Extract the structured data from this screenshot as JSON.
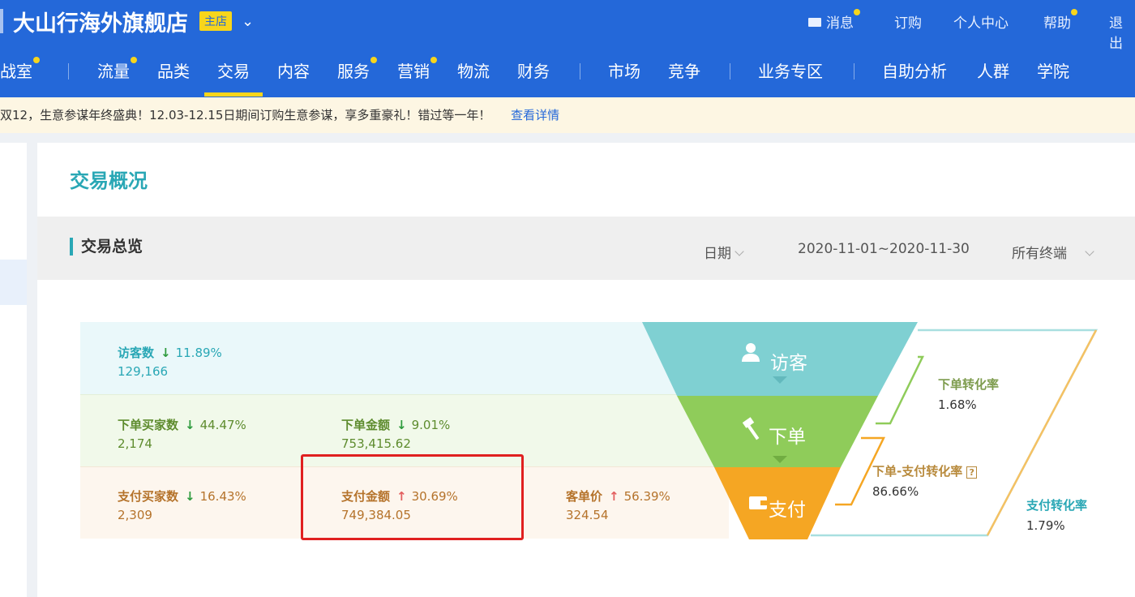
{
  "header": {
    "store_name": "大山行海外旗舰店",
    "store_tag": "主店",
    "util_links": [
      "消息",
      "订购",
      "个人中心",
      "帮助",
      "退出"
    ],
    "nav_items": [
      {
        "label": "作战室",
        "dot": true
      },
      {
        "label": "流量",
        "dot": true
      },
      {
        "label": "品类",
        "dot": false
      },
      {
        "label": "交易",
        "dot": false,
        "active": true
      },
      {
        "label": "内容",
        "dot": false
      },
      {
        "label": "服务",
        "dot": true
      },
      {
        "label": "营销",
        "dot": true
      },
      {
        "label": "物流",
        "dot": false
      },
      {
        "label": "财务",
        "dot": false
      },
      {
        "label": "市场",
        "dot": false
      },
      {
        "label": "竞争",
        "dot": false
      },
      {
        "label": "业务专区",
        "dot": false
      },
      {
        "label": "自助分析",
        "dot": false
      },
      {
        "label": "人群",
        "dot": false
      },
      {
        "label": "学院",
        "dot": false
      }
    ]
  },
  "notice": {
    "text": "双12，生意参谋年终盛典！12.03-12.15日期间订购生意参谋，享多重豪礼！错过等一年！",
    "link": "查看详情"
  },
  "page": {
    "title": "交易概况",
    "section_title": "交易总览",
    "filter_date_label": "日期",
    "date_range": "2020-11-01~2020-11-30",
    "terminal": "所有终端"
  },
  "metrics": {
    "visitors": {
      "label": "访客数",
      "change": "11.89%",
      "direction": "down",
      "value": "129,166"
    },
    "order_buyers": {
      "label": "下单买家数",
      "change": "44.47%",
      "direction": "down",
      "value": "2,174"
    },
    "order_amount": {
      "label": "下单金额",
      "change": "9.01%",
      "direction": "down",
      "value": "753,415.62"
    },
    "pay_buyers": {
      "label": "支付买家数",
      "change": "16.43%",
      "direction": "down",
      "value": "2,309"
    },
    "pay_amount": {
      "label": "支付金额",
      "change": "30.69%",
      "direction": "up",
      "value": "749,384.05"
    },
    "avg_order": {
      "label": "客单价",
      "change": "56.39%",
      "direction": "up",
      "value": "324.54"
    }
  },
  "funnel": {
    "stages": [
      "访客",
      "下单",
      "支付"
    ],
    "colors": [
      "#7fd0d2",
      "#8fcc5a",
      "#f5a623"
    ],
    "rates": [
      {
        "label": "下单转化率",
        "value": "1.68%"
      },
      {
        "label": "下单-支付转化率",
        "value": "86.66%",
        "help": "?"
      },
      {
        "label": "支付转化率",
        "value": "1.79%"
      }
    ]
  }
}
